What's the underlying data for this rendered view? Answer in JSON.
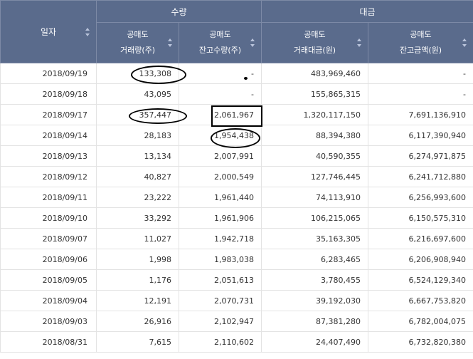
{
  "header": {
    "date": "일자",
    "group_qty": "수량",
    "group_amt": "대금",
    "cols": [
      {
        "top": "공매도",
        "bottom": "거래량(주)"
      },
      {
        "top": "공매도",
        "bottom": "잔고수량(주)"
      },
      {
        "top": "공매도",
        "bottom": "거래대금(원)"
      },
      {
        "top": "공매도",
        "bottom": "잔고금액(원)"
      }
    ]
  },
  "rows": [
    {
      "date": "2018/09/19",
      "vol": "133,308",
      "bal_qty": "-",
      "amt": "483,969,460",
      "bal_amt": "-"
    },
    {
      "date": "2018/09/18",
      "vol": "43,095",
      "bal_qty": "-",
      "amt": "155,865,315",
      "bal_amt": "-"
    },
    {
      "date": "2018/09/17",
      "vol": "357,447",
      "bal_qty": "2,061,967",
      "amt": "1,320,117,150",
      "bal_amt": "7,691,136,910"
    },
    {
      "date": "2018/09/14",
      "vol": "28,183",
      "bal_qty": "1,954,438",
      "amt": "88,394,380",
      "bal_amt": "6,117,390,940"
    },
    {
      "date": "2018/09/13",
      "vol": "13,134",
      "bal_qty": "2,007,991",
      "amt": "40,590,355",
      "bal_amt": "6,274,971,875"
    },
    {
      "date": "2018/09/12",
      "vol": "40,827",
      "bal_qty": "2,000,549",
      "amt": "127,746,445",
      "bal_amt": "6,241,712,880"
    },
    {
      "date": "2018/09/11",
      "vol": "23,222",
      "bal_qty": "1,961,440",
      "amt": "74,113,910",
      "bal_amt": "6,256,993,600"
    },
    {
      "date": "2018/09/10",
      "vol": "33,292",
      "bal_qty": "1,961,906",
      "amt": "106,215,065",
      "bal_amt": "6,150,575,310"
    },
    {
      "date": "2018/09/07",
      "vol": "11,027",
      "bal_qty": "1,942,718",
      "amt": "35,163,305",
      "bal_amt": "6,216,697,600"
    },
    {
      "date": "2018/09/06",
      "vol": "1,998",
      "bal_qty": "1,983,038",
      "amt": "6,283,465",
      "bal_amt": "6,206,908,940"
    },
    {
      "date": "2018/09/05",
      "vol": "1,176",
      "bal_qty": "2,051,613",
      "amt": "3,780,455",
      "bal_amt": "6,524,129,340"
    },
    {
      "date": "2018/09/04",
      "vol": "12,191",
      "bal_qty": "2,070,731",
      "amt": "39,192,030",
      "bal_amt": "6,667,753,820"
    },
    {
      "date": "2018/09/03",
      "vol": "26,916",
      "bal_qty": "2,102,947",
      "amt": "87,381,280",
      "bal_amt": "6,782,004,075"
    },
    {
      "date": "2018/08/31",
      "vol": "7,615",
      "bal_qty": "2,110,602",
      "amt": "24,407,490",
      "bal_amt": "6,732,820,380"
    }
  ],
  "icons": {
    "sort": "sort-icon"
  }
}
